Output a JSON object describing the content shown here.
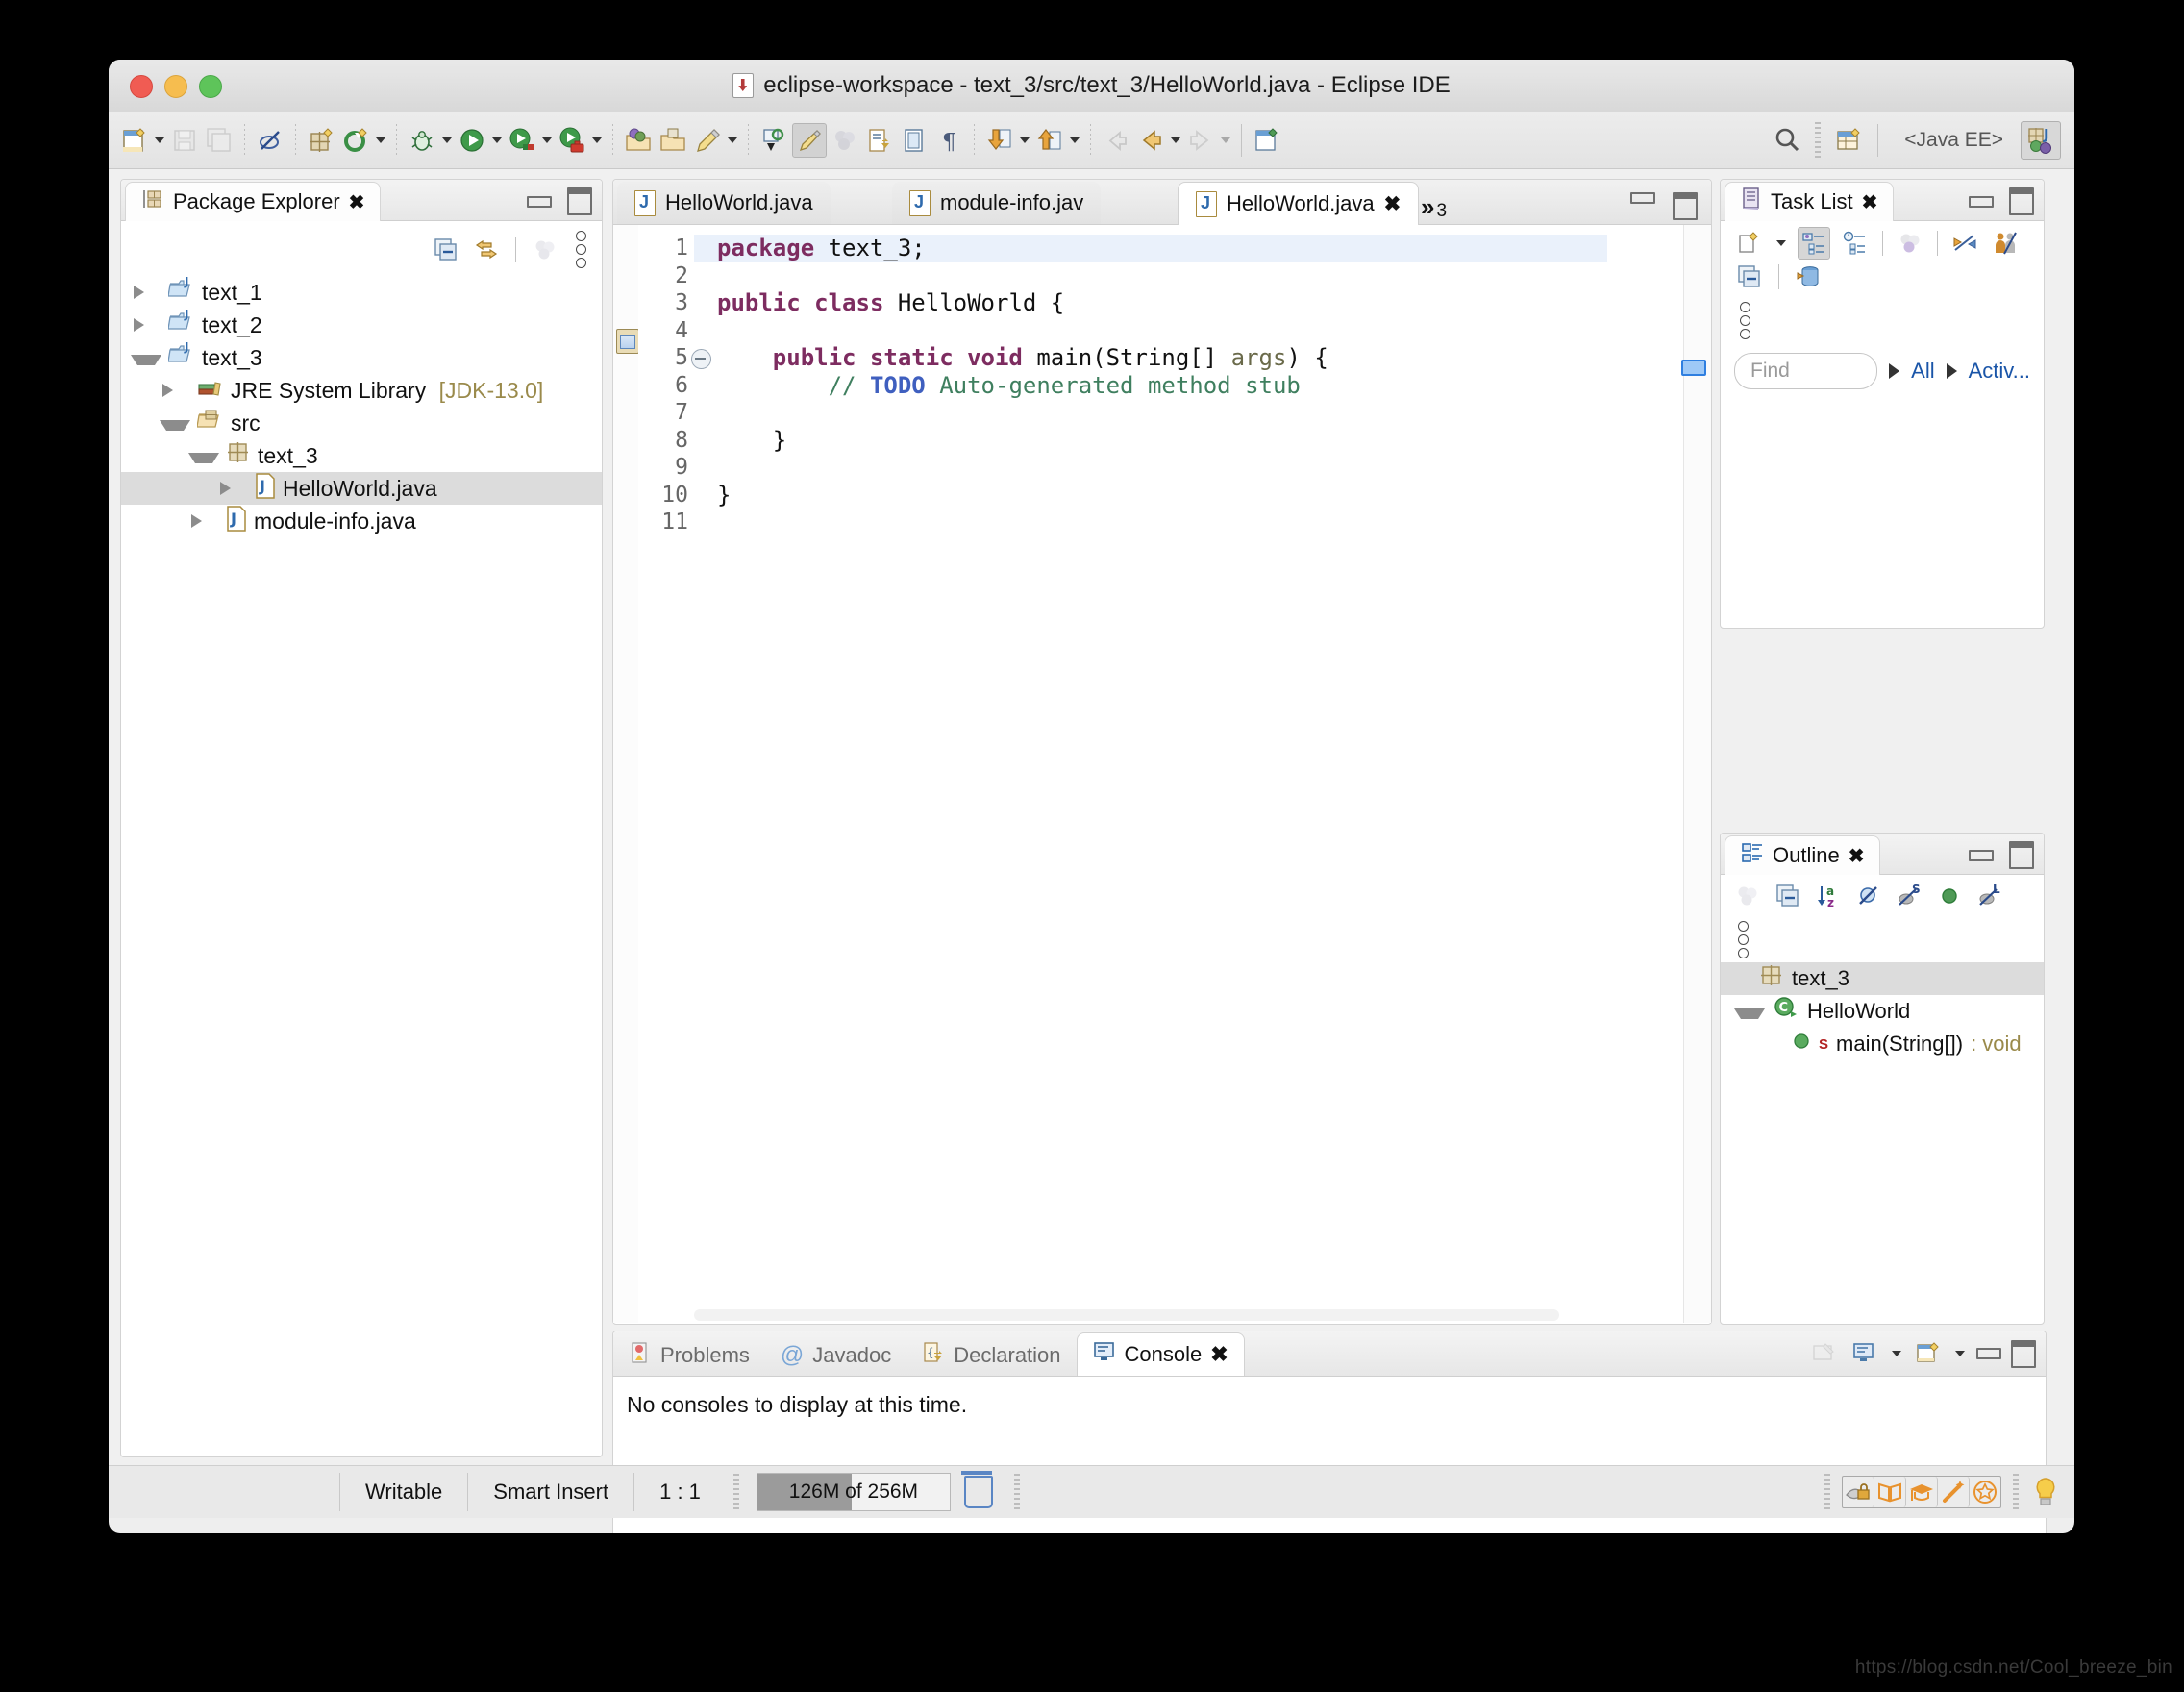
{
  "window": {
    "title": "eclipse-workspace - text_3/src/text_3/HelloWorld.java - Eclipse IDE",
    "title_icon": "java-file-icon"
  },
  "toolbar": {
    "perspective_label": "<Java EE>",
    "items": [
      {
        "name": "new-wizard",
        "icon": "new-document-icon",
        "has_menu": true
      },
      {
        "name": "save",
        "icon": "save-icon",
        "disabled": true
      },
      {
        "name": "save-all",
        "icon": "save-all-icon",
        "disabled": true
      },
      {
        "name": "toggle-annotations",
        "icon": "annotation-off-icon"
      },
      {
        "name": "new-java-package",
        "icon": "package-new-icon"
      },
      {
        "name": "external-tools",
        "icon": "run-external-icon",
        "has_menu": true
      },
      {
        "name": "debug",
        "icon": "bug-icon",
        "has_menu": true
      },
      {
        "name": "run",
        "icon": "run-green-play-icon",
        "has_menu": true
      },
      {
        "name": "run-as-server",
        "icon": "run-server-icon",
        "has_menu": true
      },
      {
        "name": "run-toolbox",
        "icon": "run-toolbox-icon",
        "has_menu": true
      },
      {
        "name": "open-type",
        "icon": "open-type-icon"
      },
      {
        "name": "open-task",
        "icon": "open-task-icon"
      },
      {
        "name": "new-task",
        "icon": "pencil-task-icon",
        "has_menu": true
      },
      {
        "name": "previous-annotation",
        "icon": "annotation-prev-icon"
      },
      {
        "name": "next-annotation",
        "icon": "highlight-pen-icon",
        "pressed": true
      },
      {
        "name": "toggle-mark-occurrences",
        "icon": "mark-occurrences-icon",
        "disabled": true
      },
      {
        "name": "open-implementation",
        "icon": "open-declaration-icon"
      },
      {
        "name": "show-whitespace",
        "icon": "show-source-icon"
      },
      {
        "name": "show-pilcrow",
        "icon": "pilcrow-icon"
      },
      {
        "name": "next-member",
        "icon": "down-arrow-member-icon",
        "has_menu": true
      },
      {
        "name": "previous-member",
        "icon": "up-arrow-member-icon",
        "has_menu": true
      },
      {
        "name": "last-edit-location",
        "icon": "last-edit-icon",
        "disabled": true
      },
      {
        "name": "back",
        "icon": "back-arrow-icon",
        "has_menu": true
      },
      {
        "name": "forward",
        "icon": "forward-arrow-icon",
        "disabled": true,
        "has_menu": true
      },
      {
        "name": "new-window",
        "icon": "new-editor-icon"
      }
    ],
    "search_icon": "search-icon",
    "perspective_open_icon": "open-perspective-icon",
    "active_perspective_icon": "java-ee-perspective-icon"
  },
  "package_explorer": {
    "tab_label": "Package Explorer",
    "tab_icon": "package-explorer-icon",
    "close_icon": "close-icon",
    "toolbar": [
      {
        "name": "collapse-all",
        "icon": "collapse-all-icon"
      },
      {
        "name": "link-with-editor",
        "icon": "link-editor-icon"
      },
      {
        "name": "focus-on-active-task",
        "icon": "focus-task-icon",
        "disabled": true
      },
      {
        "name": "view-menu",
        "icon": "kebab-menu-icon"
      }
    ],
    "tree": [
      {
        "label": "text_1",
        "icon": "java-project-icon",
        "state": "collapsed",
        "indent": 0,
        "selected": false
      },
      {
        "label": "text_2",
        "icon": "java-project-icon",
        "state": "collapsed",
        "indent": 0,
        "selected": false
      },
      {
        "label": "text_3",
        "icon": "java-project-icon",
        "state": "expanded",
        "indent": 0,
        "selected": false
      },
      {
        "label": "JRE System Library",
        "suffix": "[JDK-13.0]",
        "icon": "jre-library-icon",
        "state": "collapsed",
        "indent": 1,
        "selected": false
      },
      {
        "label": "src",
        "icon": "source-folder-icon",
        "state": "expanded",
        "indent": 1,
        "selected": false
      },
      {
        "label": "text_3",
        "icon": "package-icon",
        "state": "expanded",
        "indent": 2,
        "selected": false
      },
      {
        "label": "HelloWorld.java",
        "icon": "java-file-icon",
        "state": "collapsed",
        "indent": 3,
        "selected": true
      },
      {
        "label": "module-info.java",
        "icon": "java-file-icon",
        "state": "collapsed",
        "indent": 2,
        "selected": false
      }
    ]
  },
  "editor": {
    "tabs": [
      {
        "label": "HelloWorld.java",
        "icon": "java-file-icon",
        "active": false,
        "closeable": false
      },
      {
        "label": "module-info.jav",
        "icon": "java-file-icon",
        "active": false,
        "closeable": false
      },
      {
        "label": "HelloWorld.java",
        "icon": "java-file-icon",
        "active": true,
        "closeable": true
      }
    ],
    "overflow_chevron": "»",
    "overflow_count": "3",
    "close_icon": "close-icon",
    "line_numbers": [
      "1",
      "2",
      "3",
      "4",
      "5",
      "6",
      "7",
      "8",
      "9",
      "10",
      "11"
    ],
    "fold_line": 5,
    "marker_line": 6,
    "marker_icon": "todo-task-marker-icon",
    "current_line": 1,
    "lines": [
      [
        {
          "t": "package ",
          "c": "kw"
        },
        {
          "t": "text_3;",
          "c": ""
        }
      ],
      [],
      [
        {
          "t": "public class ",
          "c": "kw"
        },
        {
          "t": "HelloWorld {",
          "c": ""
        }
      ],
      [],
      [
        {
          "t": "    public static void ",
          "c": "kw"
        },
        {
          "t": "main(String[] ",
          "c": ""
        },
        {
          "t": "args",
          "c": "param"
        },
        {
          "t": ") {",
          "c": ""
        }
      ],
      [
        {
          "t": "        // ",
          "c": "cmt"
        },
        {
          "t": "TODO",
          "c": "todo"
        },
        {
          "t": " Auto-generated method stub",
          "c": "cmt"
        }
      ],
      [],
      [
        {
          "t": "    }",
          "c": ""
        }
      ],
      [],
      [
        {
          "t": "}",
          "c": ""
        }
      ],
      []
    ]
  },
  "task_list": {
    "tab_label": "Task List",
    "tab_icon": "task-list-icon",
    "close_icon": "close-icon",
    "toolbar_row1": [
      {
        "name": "new-task",
        "icon": "new-task-icon",
        "has_menu": true
      },
      {
        "name": "categorized-presentation",
        "icon": "categorized-icon",
        "pressed": true
      },
      {
        "name": "scheduled-presentation",
        "icon": "scheduled-icon"
      },
      {
        "name": "focus-on-workweek",
        "icon": "focus-workweek-icon",
        "disabled": true
      },
      {
        "name": "synchronize-changed",
        "icon": "synchronize-icon"
      },
      {
        "name": "show-all-tasks",
        "icon": "show-all-people-icon"
      }
    ],
    "toolbar_row2": [
      {
        "name": "collapse-all",
        "icon": "collapse-all-icon"
      },
      {
        "name": "repositories",
        "icon": "task-repository-icon"
      }
    ],
    "menu_icon": "kebab-menu-icon",
    "find_placeholder": "Find",
    "filter_all": "All",
    "filter_active": "Activ..."
  },
  "outline": {
    "tab_label": "Outline",
    "tab_icon": "outline-icon",
    "close_icon": "close-icon",
    "toolbar": [
      {
        "name": "focus-on-active-task",
        "icon": "focus-task-icon",
        "disabled": true
      },
      {
        "name": "collapse-all",
        "icon": "collapse-all-icon"
      },
      {
        "name": "sort",
        "icon": "sort-az-icon"
      },
      {
        "name": "hide-fields",
        "icon": "hide-fields-icon"
      },
      {
        "name": "hide-static",
        "icon": "hide-static-icon"
      },
      {
        "name": "hide-non-public",
        "icon": "hide-nonpublic-icon"
      },
      {
        "name": "hide-local-types",
        "icon": "hide-local-types-icon"
      }
    ],
    "menu_icon": "kebab-menu-icon",
    "tree": [
      {
        "label": "text_3",
        "icon": "package-icon",
        "indent": 0,
        "state": "none",
        "selected": true
      },
      {
        "label": "HelloWorld",
        "icon": "class-icon",
        "indent": 0,
        "state": "expanded",
        "selected": false
      },
      {
        "label": "main(String[])",
        "suffix": " : void",
        "icon": "method-icon",
        "indent": 1,
        "state": "none",
        "selected": false,
        "modifier": "S"
      }
    ]
  },
  "console": {
    "tabs": [
      {
        "label": "Problems",
        "icon": "problems-icon",
        "active": false
      },
      {
        "label": "Javadoc",
        "icon": "javadoc-at-icon",
        "active": false
      },
      {
        "label": "Declaration",
        "icon": "declaration-icon",
        "active": false
      },
      {
        "label": "Console",
        "icon": "console-icon",
        "active": true
      }
    ],
    "close_icon": "close-icon",
    "message": "No consoles to display at this time.",
    "toolbar": [
      {
        "name": "pin-console",
        "icon": "pin-console-icon",
        "disabled": true
      },
      {
        "name": "display-selected-console",
        "icon": "display-console-icon",
        "has_menu": true
      },
      {
        "name": "open-console",
        "icon": "open-console-icon",
        "has_menu": true
      }
    ],
    "minimize_icon": "minimize-icon",
    "maximize_icon": "maximize-icon"
  },
  "status_bar": {
    "writable": "Writable",
    "insert_mode": "Smart Insert",
    "cursor_position": "1 : 1",
    "memory": "126M of 256M",
    "memory_used_percent": 49,
    "trash_icon": "trash-icon",
    "right_icons": [
      {
        "name": "workspace-lock",
        "icon": "workspace-lock-icon"
      },
      {
        "name": "open-book",
        "icon": "book-icon"
      },
      {
        "name": "tutorial",
        "icon": "graduation-cap-icon"
      },
      {
        "name": "magic-wand",
        "icon": "magic-wand-icon"
      },
      {
        "name": "star",
        "icon": "star-icon"
      },
      {
        "name": "tip-of-the-day",
        "icon": "lightbulb-icon"
      }
    ]
  },
  "watermark": "https://blog.csdn.net/Cool_breeze_bin"
}
